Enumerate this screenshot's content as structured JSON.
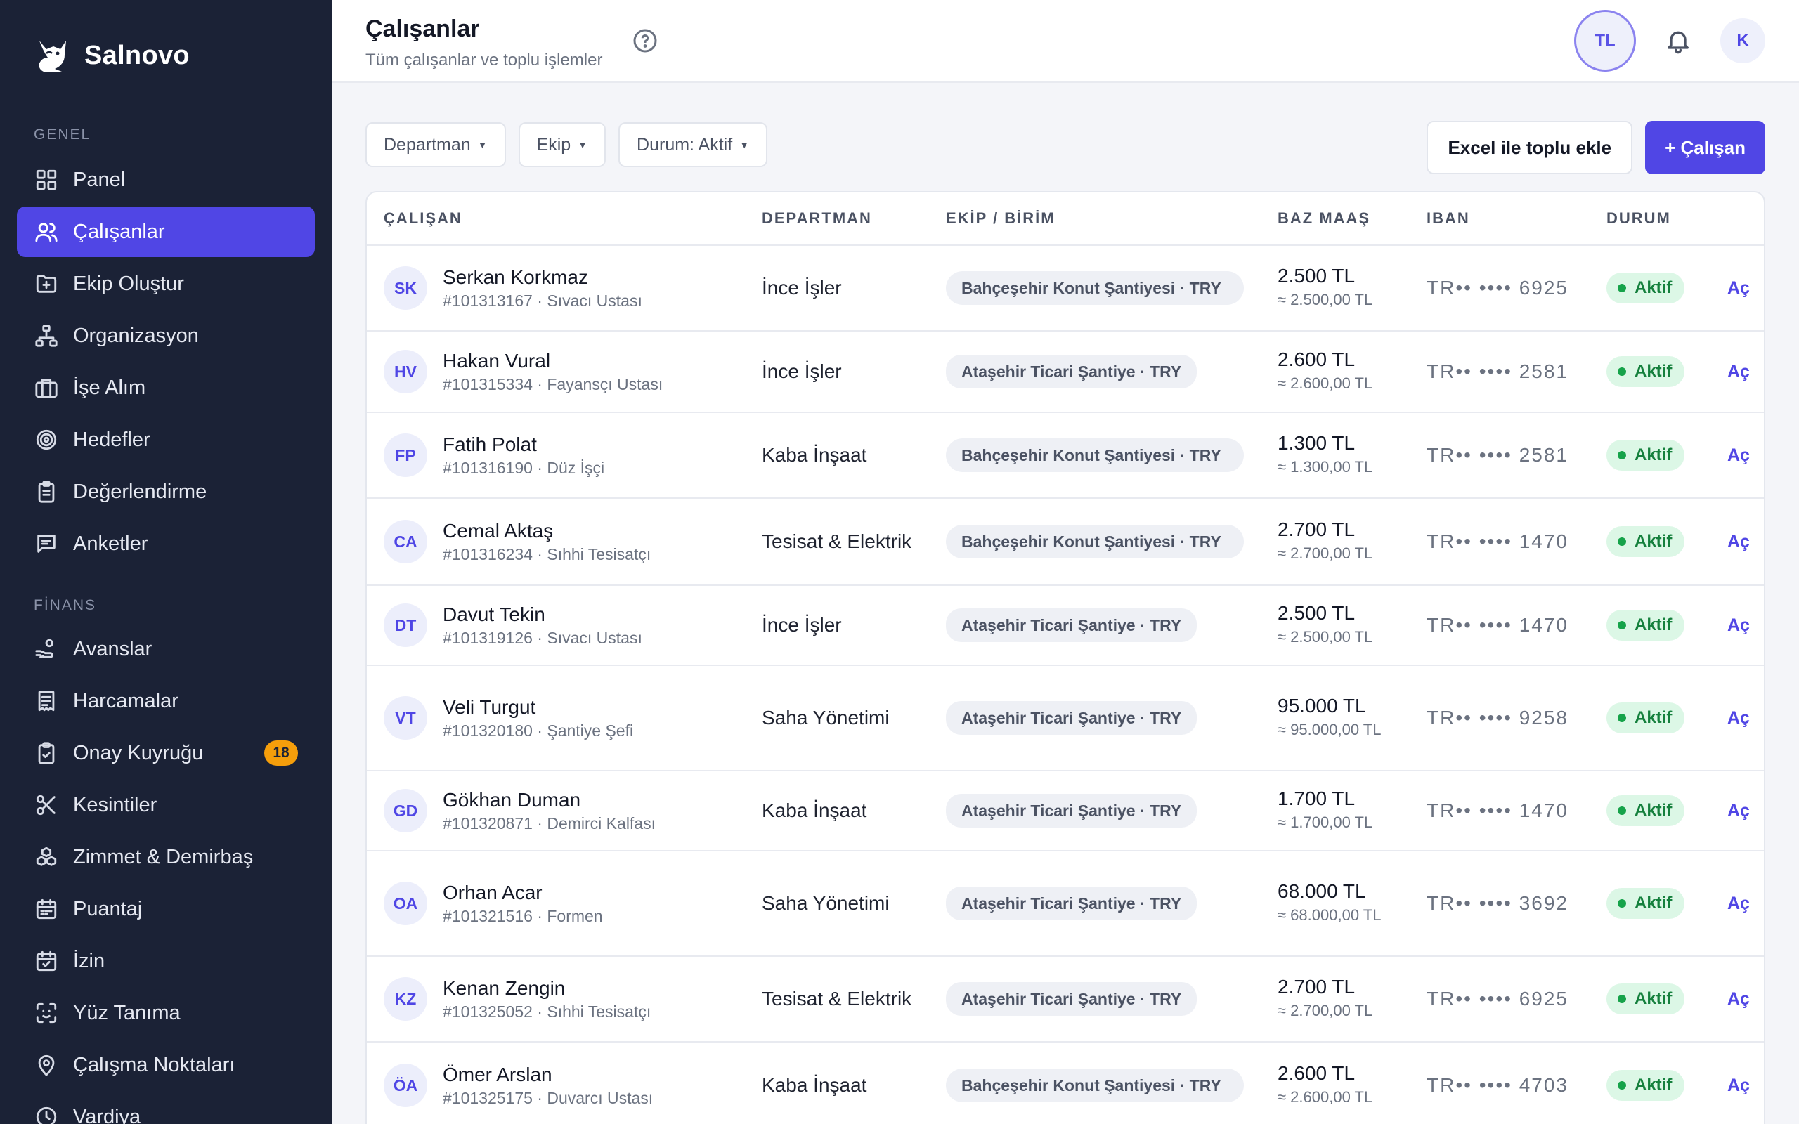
{
  "brand": {
    "name": "Salnovo"
  },
  "sidebar": {
    "sections": [
      {
        "label": "GENEL",
        "items": [
          {
            "label": "Panel",
            "icon": "grid-icon"
          },
          {
            "label": "Çalışanlar",
            "icon": "users-icon",
            "active": true
          },
          {
            "label": "Ekip Oluştur",
            "icon": "folder-plus-icon"
          },
          {
            "label": "Organizasyon",
            "icon": "org-chart-icon"
          },
          {
            "label": "İşe Alım",
            "icon": "briefcase-icon"
          },
          {
            "label": "Hedefler",
            "icon": "target-icon"
          },
          {
            "label": "Değerlendirme",
            "icon": "clipboard-icon"
          },
          {
            "label": "Anketler",
            "icon": "message-square-icon"
          }
        ]
      },
      {
        "label": "FİNANS",
        "items": [
          {
            "label": "Avanslar",
            "icon": "hand-coins-icon"
          },
          {
            "label": "Harcamalar",
            "icon": "receipt-icon"
          },
          {
            "label": "Onay Kuyruğu",
            "icon": "clipboard-check-icon",
            "badge": "18"
          },
          {
            "label": "Kesintiler",
            "icon": "scissors-icon"
          },
          {
            "label": "Zimmet & Demirbaş",
            "icon": "boxes-icon"
          },
          {
            "label": "Puantaj",
            "icon": "calendar-icon"
          },
          {
            "label": "İzin",
            "icon": "calendar-check-icon"
          },
          {
            "label": "Yüz Tanıma",
            "icon": "face-scan-icon"
          },
          {
            "label": "Çalışma Noktaları",
            "icon": "map-pin-icon"
          },
          {
            "label": "Vardiya",
            "icon": "clock-icon"
          }
        ]
      }
    ]
  },
  "header": {
    "title": "Çalışanlar",
    "subtitle": "Tüm çalışanlar ve toplu işlemler",
    "currency": "TL",
    "user_initial": "K"
  },
  "toolbar": {
    "filters": [
      "Departman",
      "Ekip",
      "Durum: Aktif"
    ],
    "bulk_add_label": "Excel ile toplu ekle",
    "add_label": "+ Çalışan"
  },
  "table": {
    "columns": [
      "ÇALIŞAN",
      "DEPARTMAN",
      "EKİP / BİRİM",
      "BAZ MAAŞ",
      "IBAN",
      "DURUM"
    ],
    "open_label": "Aç",
    "rows": [
      {
        "initials": "SK",
        "name": "Serkan Korkmaz",
        "meta": "#101313167 · Sıvacı Ustası",
        "dept": "İnce İşler",
        "team": "Bahçeşehir Konut Şantiyesi · TRY",
        "salary": "2.500 TL",
        "salary_sub": "≈ 2.500,00 TL",
        "iban": "TR•• •••• 6925",
        "status": "Aktif"
      },
      {
        "initials": "HV",
        "name": "Hakan Vural",
        "meta": "#101315334 · Fayansçı Ustası",
        "dept": "İnce İşler",
        "team": "Ataşehir Ticari Şantiye · TRY",
        "salary": "2.600 TL",
        "salary_sub": "≈ 2.600,00 TL",
        "iban": "TR•• •••• 2581",
        "status": "Aktif"
      },
      {
        "initials": "FP",
        "name": "Fatih Polat",
        "meta": "#101316190 · Düz İşçi",
        "dept": "Kaba İnşaat",
        "team": "Bahçeşehir Konut Şantiyesi · TRY",
        "salary": "1.300 TL",
        "salary_sub": "≈ 1.300,00 TL",
        "iban": "TR•• •••• 2581",
        "status": "Aktif"
      },
      {
        "initials": "CA",
        "name": "Cemal Aktaş",
        "meta": "#101316234 · Sıhhi Tesisatçı",
        "dept": "Tesisat & Elektrik",
        "team": "Bahçeşehir Konut Şantiyesi · TRY",
        "salary": "2.700 TL",
        "salary_sub": "≈ 2.700,00 TL",
        "iban": "TR•• •••• 1470",
        "status": "Aktif"
      },
      {
        "initials": "DT",
        "name": "Davut Tekin",
        "meta": "#101319126 · Sıvacı Ustası",
        "dept": "İnce İşler",
        "team": "Ataşehir Ticari Şantiye · TRY",
        "salary": "2.500 TL",
        "salary_sub": "≈ 2.500,00 TL",
        "iban": "TR•• •••• 1470",
        "status": "Aktif"
      },
      {
        "initials": "VT",
        "name": "Veli Turgut",
        "meta": "#101320180 · Şantiye Şefi",
        "dept": "Saha Yönetimi",
        "team": "Ataşehir Ticari Şantiye · TRY",
        "salary": "95.000 TL",
        "salary_sub": "≈ 95.000,00 TL",
        "iban": "TR•• •••• 9258",
        "status": "Aktif"
      },
      {
        "initials": "GD",
        "name": "Gökhan Duman",
        "meta": "#101320871 · Demirci Kalfası",
        "dept": "Kaba İnşaat",
        "team": "Ataşehir Ticari Şantiye · TRY",
        "salary": "1.700 TL",
        "salary_sub": "≈ 1.700,00 TL",
        "iban": "TR•• •••• 1470",
        "status": "Aktif"
      },
      {
        "initials": "OA",
        "name": "Orhan Acar",
        "meta": "#101321516 · Formen",
        "dept": "Saha Yönetimi",
        "team": "Ataşehir Ticari Şantiye · TRY",
        "salary": "68.000 TL",
        "salary_sub": "≈ 68.000,00 TL",
        "iban": "TR•• •••• 3692",
        "status": "Aktif"
      },
      {
        "initials": "KZ",
        "name": "Kenan Zengin",
        "meta": "#101325052 · Sıhhi Tesisatçı",
        "dept": "Tesisat & Elektrik",
        "team": "Ataşehir Ticari Şantiye · TRY",
        "salary": "2.700 TL",
        "salary_sub": "≈ 2.700,00 TL",
        "iban": "TR•• •••• 6925",
        "status": "Aktif"
      },
      {
        "initials": "ÖA",
        "name": "Ömer Arslan",
        "meta": "#101325175 · Duvarcı Ustası",
        "dept": "Kaba İnşaat",
        "team": "Bahçeşehir Konut Şantiyesi · TRY",
        "salary": "2.600 TL",
        "salary_sub": "≈ 2.600,00 TL",
        "iban": "TR•• •••• 4703",
        "status": "Aktif"
      }
    ]
  }
}
